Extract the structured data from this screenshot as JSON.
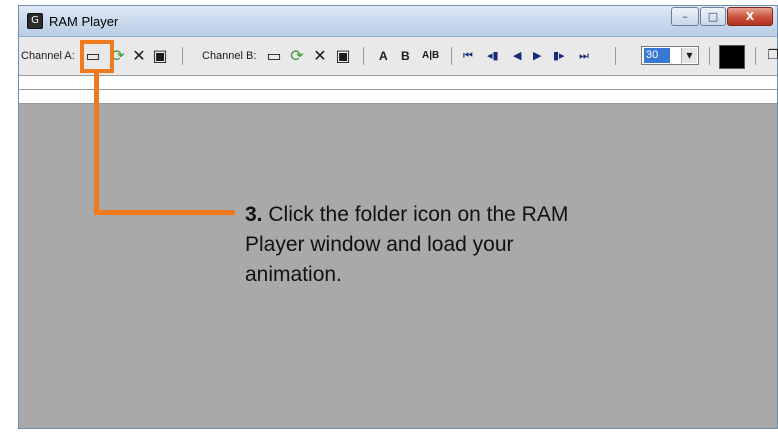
{
  "window": {
    "title": "RAM Player",
    "app_icon_glyph": "G",
    "buttons": {
      "minimize": "–",
      "maximize": "□",
      "close": "X"
    }
  },
  "toolbar": {
    "channel_a_label": "Channel A:",
    "channel_b_label": "Channel B:",
    "channel_a_icons": [
      "open-folder-icon",
      "cache-reload-icon",
      "close-x-icon",
      "save-disk-icon"
    ],
    "channel_b_icons": [
      "open-folder-icon",
      "cache-reload-icon",
      "close-x-icon",
      "save-disk-icon"
    ],
    "icon_glyphs": {
      "open": "▭",
      "reload": "⟳",
      "close": "✕",
      "save": "▣"
    },
    "ab_buttons": [
      "A",
      "B",
      "A|B"
    ],
    "playback_glyphs": {
      "first": "⏮",
      "prev_frame": "◂▮",
      "reverse": "◀",
      "play": "▶",
      "next_frame": "▮▸",
      "last": "⏭"
    },
    "frame_rate": {
      "selected": "30",
      "arrow": "▼"
    },
    "color_swatch": "#000000"
  },
  "annotation": {
    "step": "3.",
    "text": "Click the folder icon on the RAM Player window and load your animation.",
    "accent_color": "#f07a1c"
  }
}
